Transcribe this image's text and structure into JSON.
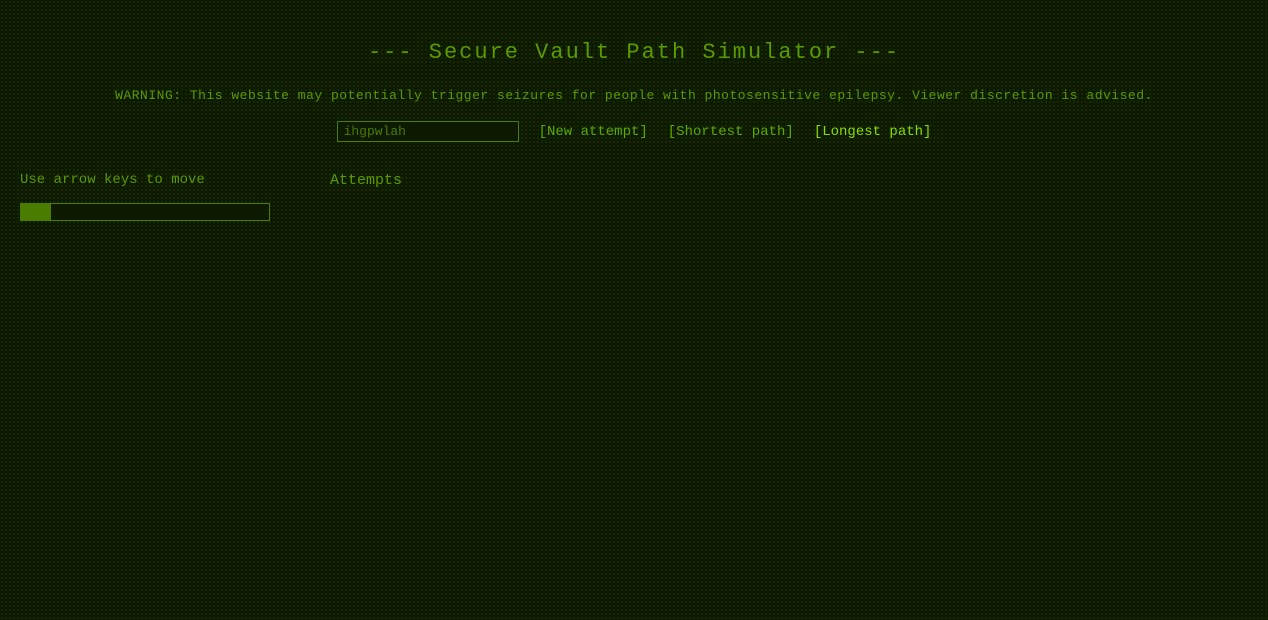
{
  "page": {
    "title": "--- Secure Vault Path Simulator ---",
    "warning": "WARNING: This website may potentially trigger seizures for people with photosensitive epilepsy. Viewer discretion is advised."
  },
  "nav": {
    "seed_value": "ihgpwlah",
    "new_attempt_label": "[New attempt]",
    "shortest_path_label": "[Shortest path]",
    "longest_path_label": "[Longest path]"
  },
  "main": {
    "instruction": "Use arrow keys to move",
    "attempts_label": "Attempts"
  },
  "colors": {
    "bg": "#0d1a00",
    "text": "#5a9900",
    "accent": "#88dd00",
    "border": "#4a7c00"
  }
}
